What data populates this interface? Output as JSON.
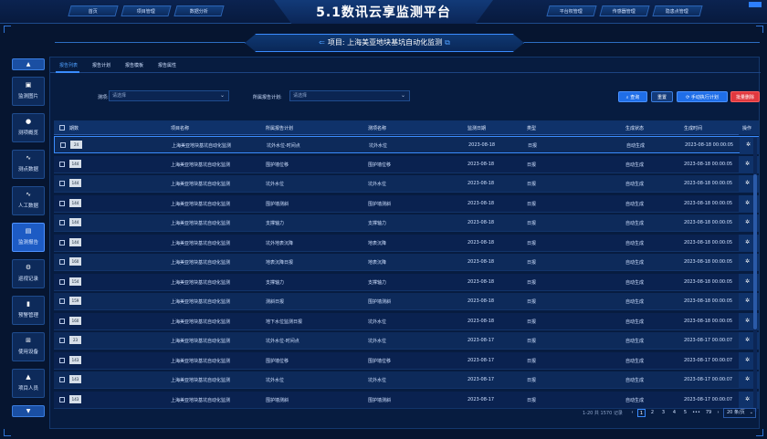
{
  "app": {
    "title": "5.1数讯云享监测平台",
    "top_nav_left": [
      "首页",
      "项目管理",
      "数据分析"
    ],
    "top_nav_right": [
      "平台权管理",
      "传感器管理",
      "隐患点管理"
    ]
  },
  "banner": {
    "project": "项目: 上海美亚地块基坑自动化监测"
  },
  "sidebar": {
    "up_label": "▲",
    "down_label": "▼",
    "items": [
      {
        "icon": "image-icon",
        "glyph": "▣",
        "label": "监测图片"
      },
      {
        "icon": "clock-icon",
        "glyph": "●",
        "label": "测项概览"
      },
      {
        "icon": "pulse-icon",
        "glyph": "∿",
        "label": "测点数据"
      },
      {
        "icon": "pulse-icon",
        "glyph": "∿",
        "label": "人工数据"
      },
      {
        "icon": "report-icon",
        "glyph": "▤",
        "label": "监测报告"
      },
      {
        "icon": "patrol-icon",
        "glyph": "⚙",
        "label": "巡视记录"
      },
      {
        "icon": "alarm-icon",
        "glyph": "▮",
        "label": "预警管理"
      },
      {
        "icon": "grid-icon",
        "glyph": "⊞",
        "label": "使用设备"
      },
      {
        "icon": "person-icon",
        "glyph": "▲",
        "label": "项目人员"
      }
    ]
  },
  "tabs": [
    "报告列表",
    "报告计划",
    "报告模板",
    "报告属性"
  ],
  "filters": {
    "period_label": "测项:",
    "period_placeholder": "请选择",
    "plan_label": "所属报告计划:",
    "plan_placeholder": "请选择"
  },
  "actions": {
    "query": "查询",
    "reset": "重置",
    "manual": "手动执行计划",
    "batch_delete": "批量删除"
  },
  "columns": [
    "期数",
    "项目名称",
    "所属报告计划",
    "测项名称",
    "监测日期",
    "类型",
    "生成状态",
    "生成时间",
    "操作"
  ],
  "rows": [
    {
      "period": "24",
      "project": "上海美亚地块基坑自动化监测",
      "plan": "坑外水位-时间点",
      "item": "坑外水位",
      "date": "2023-08-18",
      "type": "日报",
      "status": "自动生成",
      "time": "2023-08-18 00:00:05"
    },
    {
      "period": "144",
      "project": "上海美亚地块基坑自动化监测",
      "plan": "围护墙位移",
      "item": "围护墙位移",
      "date": "2023-08-18",
      "type": "日报",
      "status": "自动生成",
      "time": "2023-08-18 00:00:05"
    },
    {
      "period": "144",
      "project": "上海美亚地块基坑自动化监测",
      "plan": "坑外水位",
      "item": "坑外水位",
      "date": "2023-08-18",
      "type": "日报",
      "status": "自动生成",
      "time": "2023-08-18 00:00:05"
    },
    {
      "period": "144",
      "project": "上海美亚地块基坑自动化监测",
      "plan": "围护墙测斜",
      "item": "围护墙测斜",
      "date": "2023-08-18",
      "type": "日报",
      "status": "自动生成",
      "time": "2023-08-18 00:00:05"
    },
    {
      "period": "144",
      "project": "上海美亚地块基坑自动化监测",
      "plan": "支撑轴力",
      "item": "支撑轴力",
      "date": "2023-08-18",
      "type": "日报",
      "status": "自动生成",
      "time": "2023-08-18 00:00:05"
    },
    {
      "period": "144",
      "project": "上海美亚地块基坑自动化监测",
      "plan": "坑外地表沉降",
      "item": "地表沉降",
      "date": "2023-08-18",
      "type": "日报",
      "status": "自动生成",
      "time": "2023-08-18 00:00:05"
    },
    {
      "period": "160",
      "project": "上海美亚地块基坑自动化监测",
      "plan": "地表沉降日报",
      "item": "地表沉降",
      "date": "2023-08-18",
      "type": "日报",
      "status": "自动生成",
      "time": "2023-08-18 00:00:05"
    },
    {
      "period": "154",
      "project": "上海美亚地块基坑自动化监测",
      "plan": "支撑轴力",
      "item": "支撑轴力",
      "date": "2023-08-18",
      "type": "日报",
      "status": "自动生成",
      "time": "2023-08-18 00:00:05"
    },
    {
      "period": "159",
      "project": "上海美亚地块基坑自动化监测",
      "plan": "测斜日报",
      "item": "围护墙测斜",
      "date": "2023-08-18",
      "type": "日报",
      "status": "自动生成",
      "time": "2023-08-18 00:00:05"
    },
    {
      "period": "160",
      "project": "上海美亚地块基坑自动化监测",
      "plan": "地下水位监测日报",
      "item": "坑外水位",
      "date": "2023-08-18",
      "type": "日报",
      "status": "自动生成",
      "time": "2023-08-18 00:00:05"
    },
    {
      "period": "23",
      "project": "上海美亚地块基坑自动化监测",
      "plan": "坑外水位-时间点",
      "item": "坑外水位",
      "date": "2023-08-17",
      "type": "日报",
      "status": "自动生成",
      "time": "2023-08-17 00:00:07"
    },
    {
      "period": "143",
      "project": "上海美亚地块基坑自动化监测",
      "plan": "围护墙位移",
      "item": "围护墙位移",
      "date": "2023-08-17",
      "type": "日报",
      "status": "自动生成",
      "time": "2023-08-17 00:00:07"
    },
    {
      "period": "143",
      "project": "上海美亚地块基坑自动化监测",
      "plan": "坑外水位",
      "item": "坑外水位",
      "date": "2023-08-17",
      "type": "日报",
      "status": "自动生成",
      "time": "2023-08-17 00:00:07"
    },
    {
      "period": "143",
      "project": "上海美亚地块基坑自动化监测",
      "plan": "围护墙测斜",
      "item": "围护墙测斜",
      "date": "2023-08-17",
      "type": "日报",
      "status": "自动生成",
      "time": "2023-08-17 00:00:07"
    }
  ],
  "pagination": {
    "summary": "1-20 共 1570 记录",
    "pages": [
      "‹",
      "1",
      "2",
      "3",
      "4",
      "5",
      "•••",
      "79",
      "›"
    ],
    "page_size": "20 条/页"
  }
}
